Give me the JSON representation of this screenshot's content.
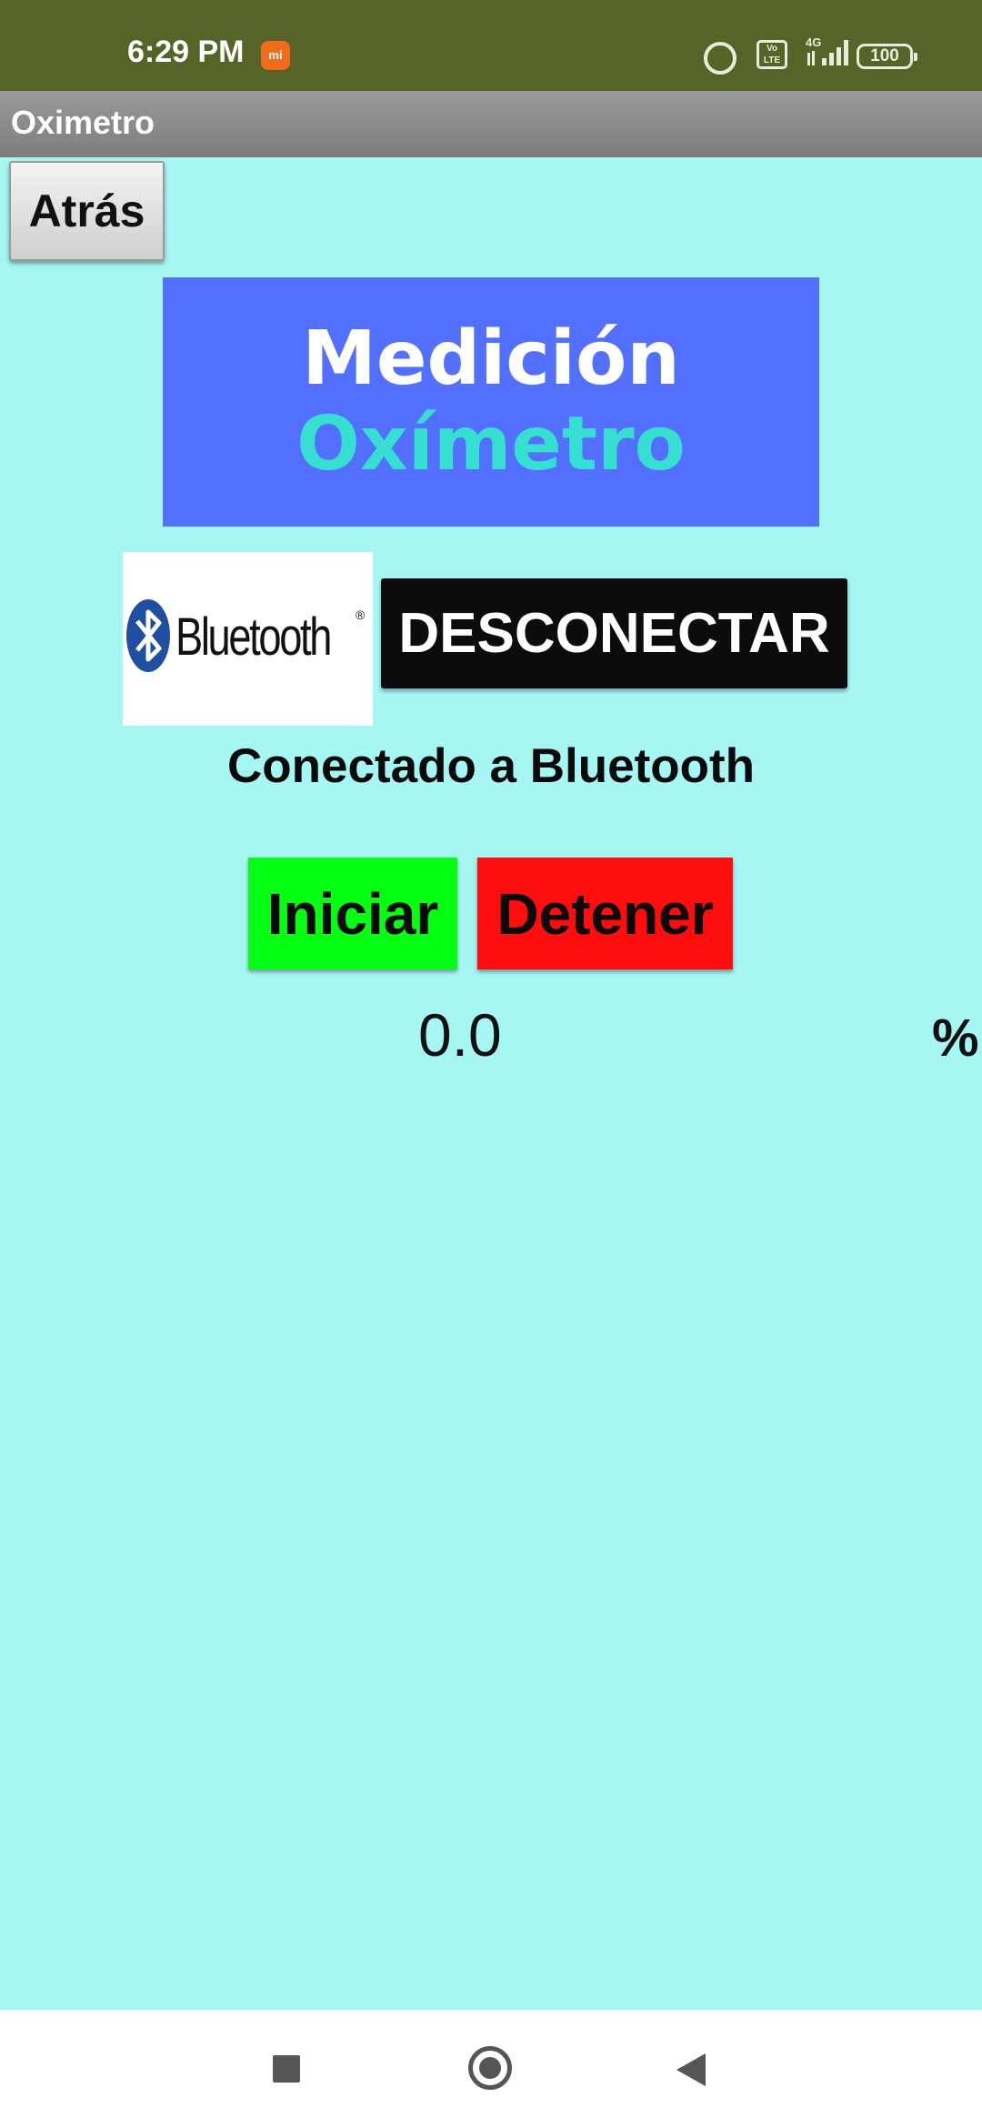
{
  "status_bar": {
    "time": "6:29 PM",
    "notification_app_badge": "mi",
    "volte_label": "Vo LTE",
    "network_type": "4G",
    "battery_level": "100",
    "icons": [
      "mi-notification-icon",
      "alarm-icon",
      "volte-icon",
      "signal-icon",
      "battery-icon"
    ]
  },
  "app_bar": {
    "title": "Oximetro"
  },
  "back_button": {
    "label": "Atrás"
  },
  "banner": {
    "line1": "Medición",
    "line2": "Oxímetro"
  },
  "bluetooth": {
    "logo_text": "Bluetooth",
    "logo_reg_mark": "®",
    "disconnect_label": "DESCONECTAR",
    "status": "Conectado a Bluetooth"
  },
  "controls": {
    "start_label": "Iniciar",
    "stop_label": "Detener"
  },
  "reading": {
    "value": "0.0",
    "unit": "%"
  },
  "colors": {
    "status_bar": "#566427",
    "background": "#a6f6f4",
    "banner": "#526ffe",
    "banner_line2": "#36dfd1",
    "disconnect": "#0b0c0e",
    "start": "#04ff12",
    "stop": "#fd0d0e"
  },
  "nav_bar": {
    "icons": [
      "recents-icon",
      "home-icon",
      "back-icon"
    ]
  }
}
